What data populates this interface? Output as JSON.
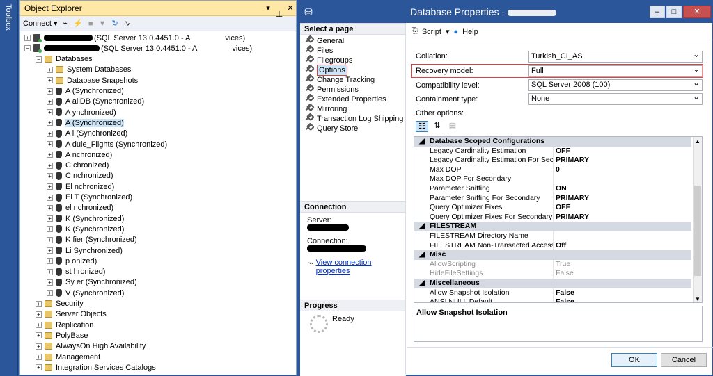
{
  "toolbox": {
    "label": "Toolbox"
  },
  "object_explorer": {
    "title": "Object Explorer",
    "title_buttons": [
      "▾",
      "ᅟ",
      "✕"
    ],
    "connect_label": "Connect ▾",
    "servers": [
      {
        "label": "(SQL Server 13.0.4451.0 - A",
        "suffix": "vices)"
      },
      {
        "label": "(SQL Server 13.0.4451.0 - A",
        "suffix": "vices)"
      }
    ],
    "databases_label": "Databases",
    "folders_top": [
      "System Databases",
      "Database Snapshots"
    ],
    "db_items": [
      "A                    (Synchronized)",
      "A                    ailDB (Synchronized)",
      "A                    ynchronized)",
      "A                    (Synchronized)",
      "A                    l (Synchronized)",
      "A                    dule_Flights (Synchronized)",
      "A                    nchronized)",
      "C                    chronized)",
      "C                    nchronized)",
      "El                   nchronized)",
      "El                   T (Synchronized)",
      "el                   nchronized)",
      "K                    (Synchronized)",
      "K                    (Synchronized)",
      "K                    fier (Synchronized)",
      "Li                   Synchronized)",
      "p                    onized)",
      "st                   hronized)",
      "Sy                   er (Synchronized)",
      "V                    (Synchronized)"
    ],
    "root_folders": [
      "Security",
      "Server Objects",
      "Replication",
      "PolyBase",
      "AlwaysOn High Availability",
      "Management",
      "Integration Services Catalogs"
    ]
  },
  "dialog": {
    "title": "Database Properties - ",
    "select_page_header": "Select a page",
    "pages": [
      "General",
      "Files",
      "Filegroups",
      "Options",
      "Change Tracking",
      "Permissions",
      "Extended Properties",
      "Mirroring",
      "Transaction Log Shipping",
      "Query Store"
    ],
    "selected_page": "Options",
    "connection_header": "Connection",
    "server_label": "Server:",
    "connection_label": "Connection:",
    "view_connection_link": "View connection properties",
    "progress_header": "Progress",
    "progress_status": "Ready",
    "toolbar": {
      "script": "Script",
      "help": "Help"
    },
    "collation_label": "Collation:",
    "collation_value": "Turkish_CI_AS",
    "recovery_label": "Recovery model:",
    "recovery_value": "Full",
    "compat_label": "Compatibility level:",
    "compat_value": "SQL Server 2008 (100)",
    "containment_label": "Containment type:",
    "containment_value": "None",
    "other_options_label": "Other options:",
    "grid": [
      {
        "cat": "Database Scoped Configurations"
      },
      {
        "name": "Legacy Cardinality Estimation",
        "value": "OFF"
      },
      {
        "name": "Legacy Cardinality Estimation For Secondary",
        "value": "PRIMARY"
      },
      {
        "name": "Max DOP",
        "value": "0"
      },
      {
        "name": "Max DOP For Secondary",
        "value": ""
      },
      {
        "name": "Parameter Sniffing",
        "value": "ON"
      },
      {
        "name": "Parameter Sniffing For Secondary",
        "value": "PRIMARY"
      },
      {
        "name": "Query Optimizer Fixes",
        "value": "OFF"
      },
      {
        "name": "Query Optimizer Fixes For Secondary",
        "value": "PRIMARY"
      },
      {
        "cat": "FILESTREAM"
      },
      {
        "name": "FILESTREAM Directory Name",
        "value": ""
      },
      {
        "name": "FILESTREAM Non-Transacted Access",
        "value": "Off"
      },
      {
        "cat": "Misc"
      },
      {
        "name": "AllowScripting",
        "value": "True",
        "disabled": true
      },
      {
        "name": "HideFileSettings",
        "value": "False",
        "disabled": true
      },
      {
        "cat": "Miscellaneous"
      },
      {
        "name": "Allow Snapshot Isolation",
        "value": "False"
      },
      {
        "name": "ANSI NULL Default",
        "value": "False"
      }
    ],
    "description": "Allow Snapshot Isolation",
    "ok_label": "OK",
    "cancel_label": "Cancel"
  }
}
